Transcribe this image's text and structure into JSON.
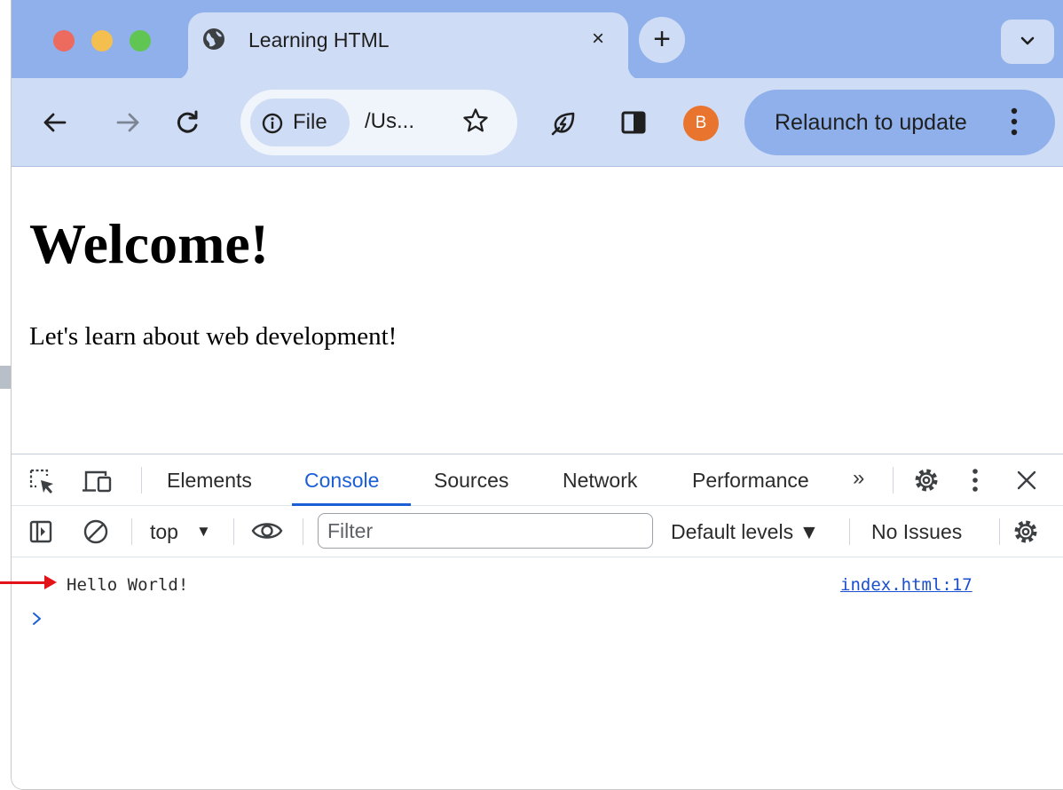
{
  "browser": {
    "tab": {
      "title": "Learning HTML",
      "close_glyph": "×"
    },
    "new_tab_glyph": "+",
    "address": {
      "site_chip": "File",
      "url": "/Us..."
    },
    "avatar_initial": "B",
    "relaunch_label": "Relaunch to update",
    "colors": {
      "tabstrip": "#8fb0ea",
      "toolbar": "#cfdcf5",
      "avatar": "#e8742e"
    },
    "icons": [
      "globe-icon",
      "back-arrow-icon",
      "forward-arrow-icon",
      "reload-icon",
      "info-icon",
      "star-icon",
      "leaf-icon",
      "side-panel-icon",
      "kebab-menu-icon",
      "chevron-down-icon"
    ]
  },
  "page": {
    "heading": "Welcome!",
    "paragraph": "Let's learn about web development!"
  },
  "devtools": {
    "tabs": [
      "Elements",
      "Console",
      "Sources",
      "Network",
      "Performance"
    ],
    "active_tab": "Console",
    "more_tabs_glyph": "»",
    "console_toolbar": {
      "context": "top",
      "context_caret": "▼",
      "filter_placeholder": "Filter",
      "levels": "Default levels ▼",
      "issues": "No Issues"
    },
    "log": [
      {
        "message": "Hello World!",
        "source": "index.html:17"
      }
    ],
    "accent": "#1a5fd6"
  }
}
